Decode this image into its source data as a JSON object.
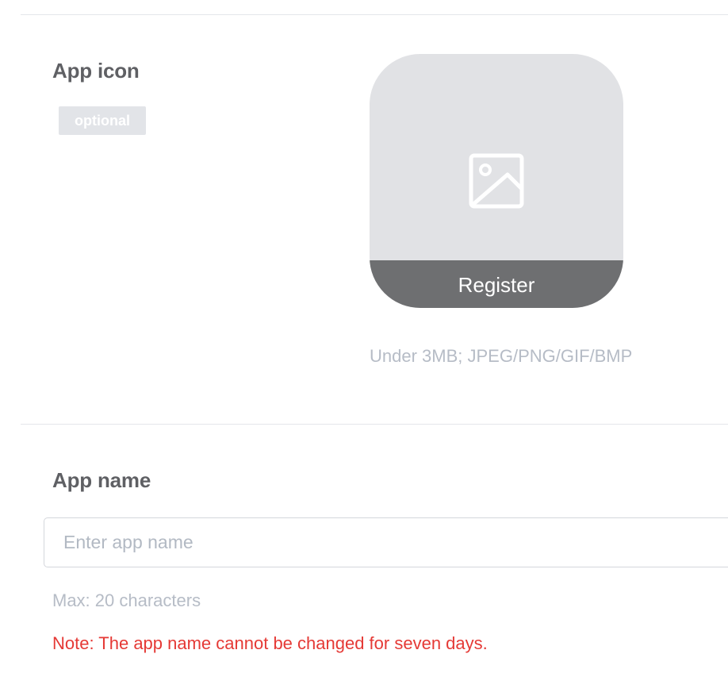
{
  "app_icon_section": {
    "title": "App icon",
    "optional_badge": "optional",
    "register_label": "Register",
    "upload_hint": "Under 3MB; JPEG/PNG/GIF/BMP",
    "placeholder_icon": "image-icon"
  },
  "app_name_section": {
    "title": "App name",
    "input_value": "",
    "input_placeholder": "Enter app name",
    "max_hint": "Max: 20 characters",
    "note": "Note: The app name cannot be changed for seven days."
  },
  "colors": {
    "note_red": "#e53935",
    "hint_gray": "#b6bcc6",
    "tile_bg": "#e1e2e5",
    "register_bar": "#6e6f71"
  }
}
